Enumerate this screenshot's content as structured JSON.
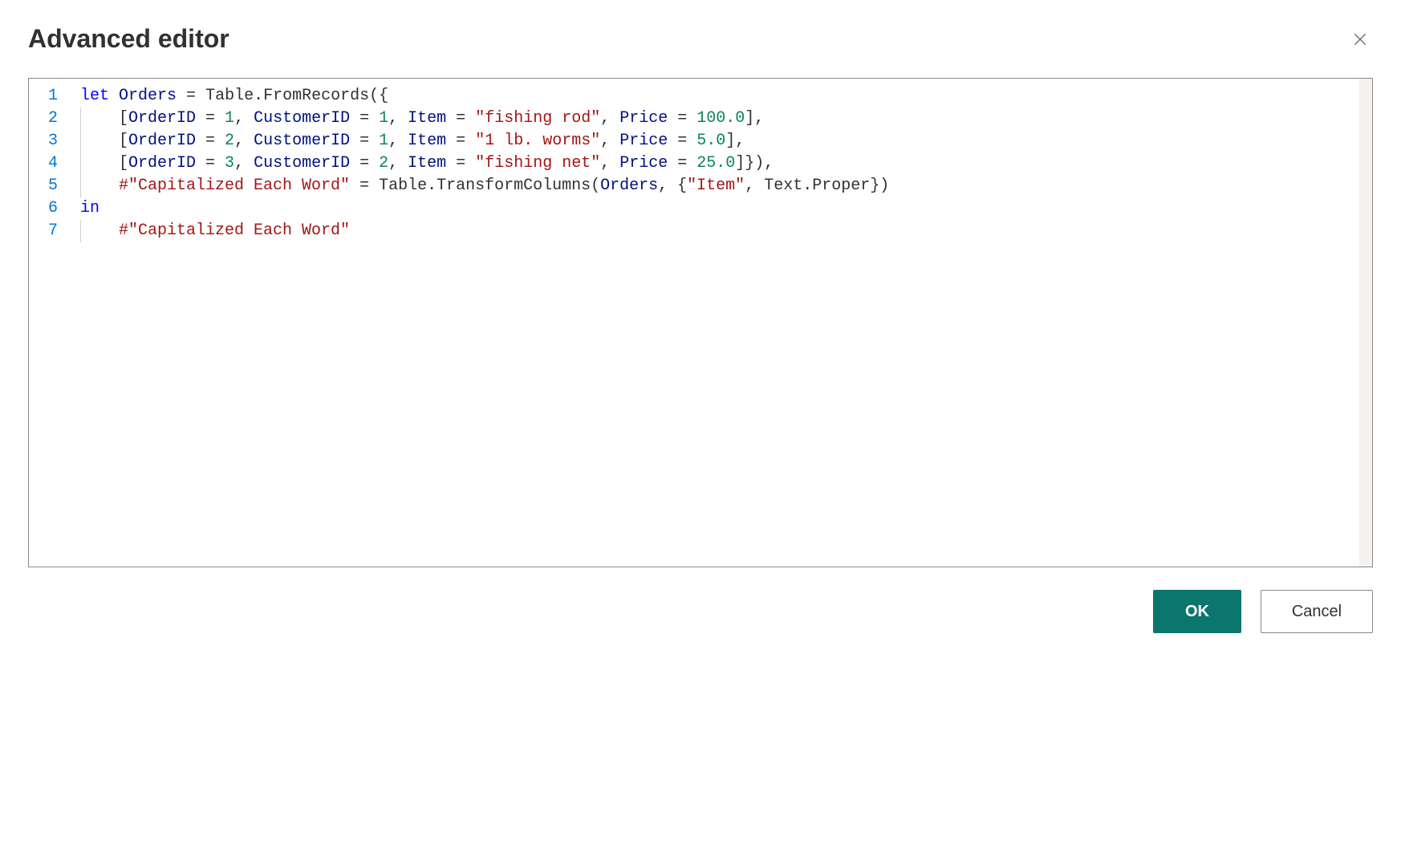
{
  "dialog": {
    "title": "Advanced editor",
    "ok_label": "OK",
    "cancel_label": "Cancel"
  },
  "editor": {
    "line_numbers": [
      "1",
      "2",
      "3",
      "4",
      "5",
      "6",
      "7"
    ],
    "lines": [
      {
        "indent": 0,
        "tokens": [
          {
            "t": "kw",
            "v": "let"
          },
          {
            "t": "punct",
            "v": " "
          },
          {
            "t": "ident",
            "v": "Orders"
          },
          {
            "t": "punct",
            "v": " = "
          },
          {
            "t": "func",
            "v": "Table.FromRecords"
          },
          {
            "t": "punct",
            "v": "({"
          }
        ]
      },
      {
        "indent": 1,
        "tokens": [
          {
            "t": "punct",
            "v": "    ["
          },
          {
            "t": "ident",
            "v": "OrderID"
          },
          {
            "t": "punct",
            "v": " = "
          },
          {
            "t": "num",
            "v": "1"
          },
          {
            "t": "punct",
            "v": ", "
          },
          {
            "t": "ident",
            "v": "CustomerID"
          },
          {
            "t": "punct",
            "v": " = "
          },
          {
            "t": "num",
            "v": "1"
          },
          {
            "t": "punct",
            "v": ", "
          },
          {
            "t": "ident",
            "v": "Item"
          },
          {
            "t": "punct",
            "v": " = "
          },
          {
            "t": "str",
            "v": "\"fishing rod\""
          },
          {
            "t": "punct",
            "v": ", "
          },
          {
            "t": "ident",
            "v": "Price"
          },
          {
            "t": "punct",
            "v": " = "
          },
          {
            "t": "num",
            "v": "100.0"
          },
          {
            "t": "punct",
            "v": "],"
          }
        ]
      },
      {
        "indent": 1,
        "tokens": [
          {
            "t": "punct",
            "v": "    ["
          },
          {
            "t": "ident",
            "v": "OrderID"
          },
          {
            "t": "punct",
            "v": " = "
          },
          {
            "t": "num",
            "v": "2"
          },
          {
            "t": "punct",
            "v": ", "
          },
          {
            "t": "ident",
            "v": "CustomerID"
          },
          {
            "t": "punct",
            "v": " = "
          },
          {
            "t": "num",
            "v": "1"
          },
          {
            "t": "punct",
            "v": ", "
          },
          {
            "t": "ident",
            "v": "Item"
          },
          {
            "t": "punct",
            "v": " = "
          },
          {
            "t": "str",
            "v": "\"1 lb. worms\""
          },
          {
            "t": "punct",
            "v": ", "
          },
          {
            "t": "ident",
            "v": "Price"
          },
          {
            "t": "punct",
            "v": " = "
          },
          {
            "t": "num",
            "v": "5.0"
          },
          {
            "t": "punct",
            "v": "],"
          }
        ]
      },
      {
        "indent": 1,
        "tokens": [
          {
            "t": "punct",
            "v": "    ["
          },
          {
            "t": "ident",
            "v": "OrderID"
          },
          {
            "t": "punct",
            "v": " = "
          },
          {
            "t": "num",
            "v": "3"
          },
          {
            "t": "punct",
            "v": ", "
          },
          {
            "t": "ident",
            "v": "CustomerID"
          },
          {
            "t": "punct",
            "v": " = "
          },
          {
            "t": "num",
            "v": "2"
          },
          {
            "t": "punct",
            "v": ", "
          },
          {
            "t": "ident",
            "v": "Item"
          },
          {
            "t": "punct",
            "v": " = "
          },
          {
            "t": "str",
            "v": "\"fishing net\""
          },
          {
            "t": "punct",
            "v": ", "
          },
          {
            "t": "ident",
            "v": "Price"
          },
          {
            "t": "punct",
            "v": " = "
          },
          {
            "t": "num",
            "v": "25.0"
          },
          {
            "t": "punct",
            "v": "]}),"
          }
        ]
      },
      {
        "indent": 1,
        "tokens": [
          {
            "t": "punct",
            "v": "    "
          },
          {
            "t": "hashstr",
            "v": "#\"Capitalized Each Word\""
          },
          {
            "t": "punct",
            "v": " = "
          },
          {
            "t": "func",
            "v": "Table.TransformColumns"
          },
          {
            "t": "punct",
            "v": "("
          },
          {
            "t": "ident",
            "v": "Orders"
          },
          {
            "t": "punct",
            "v": ", {"
          },
          {
            "t": "str",
            "v": "\"Item\""
          },
          {
            "t": "punct",
            "v": ", "
          },
          {
            "t": "func",
            "v": "Text.Proper"
          },
          {
            "t": "punct",
            "v": "})"
          }
        ]
      },
      {
        "indent": 0,
        "tokens": [
          {
            "t": "kw",
            "v": "in"
          }
        ]
      },
      {
        "indent": 1,
        "tokens": [
          {
            "t": "punct",
            "v": "    "
          },
          {
            "t": "hashstr",
            "v": "#\"Capitalized Each Word\""
          }
        ]
      }
    ]
  }
}
